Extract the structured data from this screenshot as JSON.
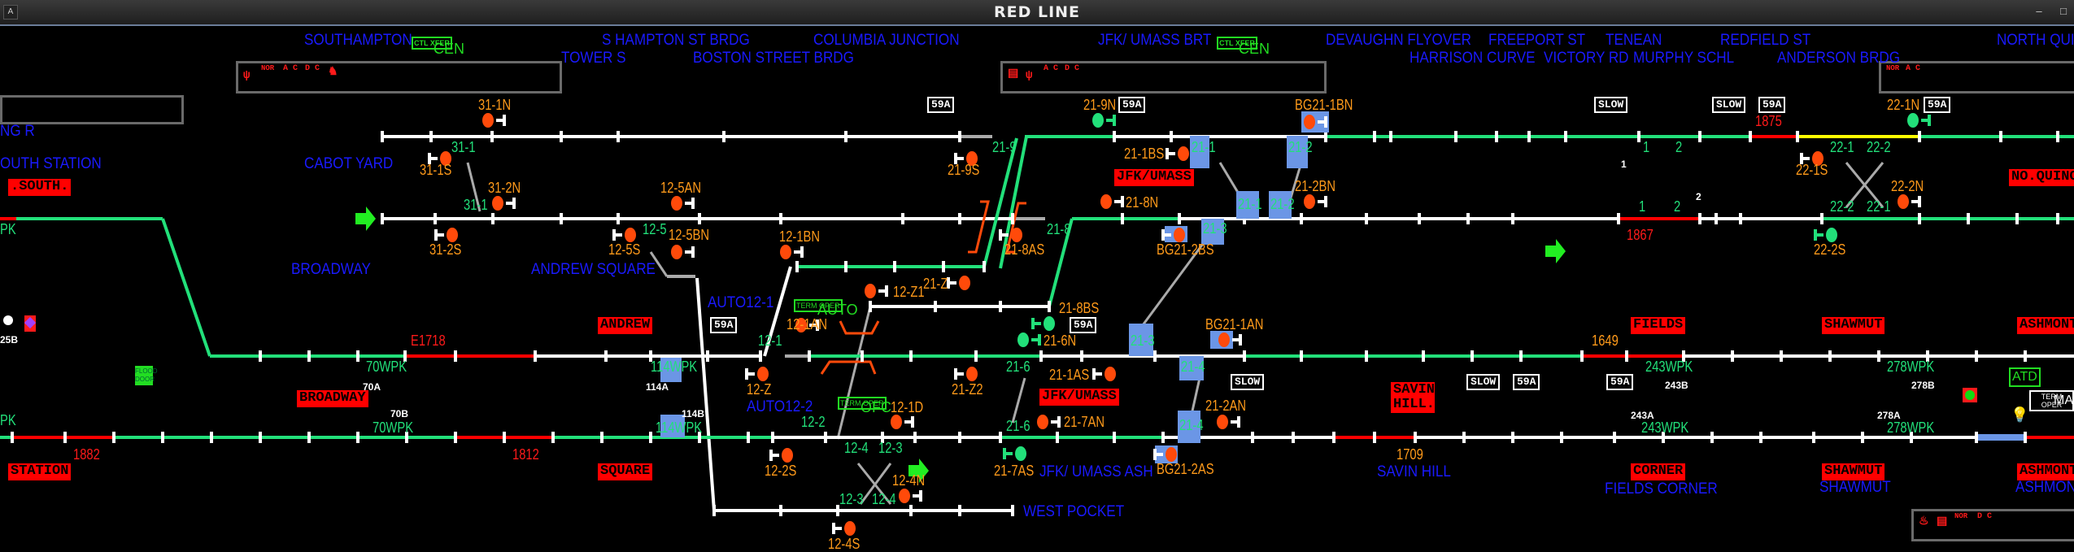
{
  "window": {
    "title": "RED LINE",
    "app_icon": "A",
    "minimize": "–",
    "maximize": "□"
  },
  "colors": {
    "track_idle": "#ffffff",
    "track_clear": "#22e07a",
    "track_occupied": "#ff0000",
    "track_locked": "#ffff00",
    "switch_box": "#6b96e6",
    "signal_stop": "#ff4a0a",
    "signal_clear": "#22e07a",
    "label_blue": "#1a1aff"
  },
  "locations_top": [
    {
      "id": "southampton",
      "text": "SOUTHAMPTON"
    },
    {
      "id": "s-hampton-st-brdg",
      "text": "S HAMPTON ST BRDG"
    },
    {
      "id": "columbia-junction",
      "text": "COLUMBIA JUNCTION"
    },
    {
      "id": "tower-s",
      "text": "TOWER S"
    },
    {
      "id": "boston-street-brdg",
      "text": "BOSTON STREET BRDG"
    },
    {
      "id": "jfk-umass-brt",
      "text": "JFK/ UMASS BRT"
    },
    {
      "id": "devaughn-flyover",
      "text": "DEVAUGHN FLYOVER"
    },
    {
      "id": "freeport-st",
      "text": "FREEPORT ST"
    },
    {
      "id": "tenean",
      "text": "TENEAN"
    },
    {
      "id": "redfield-st",
      "text": "REDFIELD ST"
    },
    {
      "id": "north-quincy",
      "text": "NORTH QUI"
    },
    {
      "id": "harrison-curve",
      "text": "HARRISON CURVE"
    },
    {
      "id": "victory-rd",
      "text": "VICTORY RD"
    },
    {
      "id": "murphy-schl",
      "text": "MURPHY SCHL"
    },
    {
      "id": "anderson-brdg",
      "text": "ANDERSON BRDG"
    }
  ],
  "locations_mid": [
    {
      "id": "ng-r",
      "text": "NG R"
    },
    {
      "id": "south-station",
      "text": "OUTH STATION"
    },
    {
      "id": "cabot-yard",
      "text": "CABOT YARD"
    },
    {
      "id": "broadway",
      "text": "BROADWAY"
    },
    {
      "id": "andrew-square",
      "text": "ANDREW SQUARE"
    },
    {
      "id": "auto12-1",
      "text": "AUTO12-1"
    },
    {
      "id": "auto12-2",
      "text": "AUTO12-2"
    },
    {
      "id": "west-pocket",
      "text": "WEST POCKET"
    },
    {
      "id": "jfk-umass-ash",
      "text": "JFK/ UMASS ASH"
    },
    {
      "id": "savin-hill",
      "text": "SAVIN HILL"
    },
    {
      "id": "fields-corner",
      "text": "FIELDS CORNER"
    },
    {
      "id": "shawmut",
      "text": "SHAWMUT"
    },
    {
      "id": "ashmont",
      "text": "ASHMON"
    }
  ],
  "control": {
    "ctl_xfer": "CTL XFER",
    "cen": "CEN",
    "term_oper": "TERM OPER",
    "auto": "AUTO",
    "ofc": "OFC",
    "atd": "ATD",
    "flood_door": "FLOOD DOOR",
    "ma": "MA"
  },
  "station_tags": [
    {
      "id": "south",
      "text": ".SOUTH."
    },
    {
      "id": "andrew",
      "text": "ANDREW"
    },
    {
      "id": "broadway",
      "text": "BROADWAY"
    },
    {
      "id": "station",
      "text": "STATION"
    },
    {
      "id": "square",
      "text": "SQUARE"
    },
    {
      "id": "jfk-umass-1",
      "text": "JFK/UMASS"
    },
    {
      "id": "jfk-umass-2",
      "text": "JFK/UMASS"
    },
    {
      "id": "savin-hill",
      "text": "SAVIN HILL."
    },
    {
      "id": "fields",
      "text": "FIELDS"
    },
    {
      "id": "corner",
      "text": "CORNER"
    },
    {
      "id": "shawmut-1",
      "text": "SHAWMUT"
    },
    {
      "id": "shawmut-2",
      "text": "SHAWMUT"
    },
    {
      "id": "ashmont-1",
      "text": "ASHMONT"
    },
    {
      "id": "ashmont-2",
      "text": "ASHMONT"
    },
    {
      "id": "no-quincy",
      "text": "NO.QUINC"
    }
  ],
  "signals": [
    {
      "id": "31-1N",
      "text": "31-1N",
      "state": "stop"
    },
    {
      "id": "31-1S",
      "text": "31-1S",
      "state": "stop"
    },
    {
      "id": "31-2N",
      "text": "31-2N",
      "state": "stop"
    },
    {
      "id": "31-2S",
      "text": "31-2S",
      "state": "stop"
    },
    {
      "id": "12-5AN",
      "text": "12-5AN",
      "state": "stop"
    },
    {
      "id": "12-5S",
      "text": "12-5S",
      "state": "stop"
    },
    {
      "id": "12-5BN",
      "text": "12-5BN",
      "state": "stop"
    },
    {
      "id": "12-1BN",
      "text": "12-1BN",
      "state": "stop"
    },
    {
      "id": "12-1AN",
      "text": "12-1AN",
      "state": "stop"
    },
    {
      "id": "12-Z1",
      "text": "12-Z1",
      "state": "stop"
    },
    {
      "id": "21-Z",
      "text": "21-Z",
      "state": "stop"
    },
    {
      "id": "12-Z",
      "text": "12-Z",
      "state": "stop"
    },
    {
      "id": "21-Z2",
      "text": "21-Z2",
      "state": "stop"
    },
    {
      "id": "12-2S",
      "text": "12-2S",
      "state": "stop"
    },
    {
      "id": "12-4N",
      "text": "12-4N",
      "state": "stop"
    },
    {
      "id": "12-4S",
      "text": "12-4S",
      "state": "stop"
    },
    {
      "id": "12-1D",
      "text": "12-1D",
      "state": "stop"
    },
    {
      "id": "21-9S",
      "text": "21-9S",
      "state": "stop"
    },
    {
      "id": "21-9N",
      "text": "21-9N",
      "state": "clear"
    },
    {
      "id": "21-8AS",
      "text": "21-8AS",
      "state": "stop"
    },
    {
      "id": "21-8N",
      "text": "21-8N",
      "state": "stop"
    },
    {
      "id": "21-8BS",
      "text": "21-8BS",
      "state": "clear"
    },
    {
      "id": "21-6N",
      "text": "21-6N",
      "state": "clear"
    },
    {
      "id": "21-1AS",
      "text": "21-1AS",
      "state": "stop"
    },
    {
      "id": "21-7AN",
      "text": "21-7AN",
      "state": "stop"
    },
    {
      "id": "21-7AS",
      "text": "21-7AS",
      "state": "clear"
    },
    {
      "id": "21-1BS",
      "text": "21-1BS",
      "state": "stop"
    },
    {
      "id": "BG21-1BN",
      "text": "BG21-1BN",
      "state": "stop"
    },
    {
      "id": "21-2BN",
      "text": "21-2BN",
      "state": "stop"
    },
    {
      "id": "BG21-2BS",
      "text": "BG21-2BS",
      "state": "stop"
    },
    {
      "id": "BG21-1AN",
      "text": "BG21-1AN",
      "state": "stop"
    },
    {
      "id": "21-2AN",
      "text": "21-2AN",
      "state": "stop"
    },
    {
      "id": "BG21-2AS",
      "text": "BG21-2AS",
      "state": "stop"
    },
    {
      "id": "22-1S",
      "text": "22-1S",
      "state": "stop"
    },
    {
      "id": "22-1N",
      "text": "22-1N",
      "state": "clear"
    },
    {
      "id": "22-2N",
      "text": "22-2N",
      "state": "stop"
    },
    {
      "id": "22-2S",
      "text": "22-2S",
      "state": "clear"
    }
  ],
  "switch_labels": {
    "s31_1a": "31-1",
    "s31_1b": "31-1",
    "s12_5": "12-5",
    "s12_1": "12-1",
    "s12_2": "12-2",
    "s12_4a": "12-4",
    "s12_3a": "12-3",
    "s12_3b": "12-3",
    "s12_4b": "12-4",
    "s21_9": "21-9",
    "s21_8": "21-8",
    "s21_6a": "21-6",
    "s21_6b": "21-6",
    "s21_1a": "21-1",
    "s21_2a": "21-2",
    "s21_1b": "21-1",
    "s21_2b": "21-2",
    "s21_3a": "21-3",
    "s21_3b": "21-3",
    "s21_4a": "21-4",
    "s21_4b": "21-4",
    "x1a": "1",
    "x2a": "2",
    "x1b": "1",
    "x2b": "2",
    "s22_1a": "22-1",
    "s22_2a": "22-2",
    "s22_2b": "22-2",
    "s22_1b": "22-1"
  },
  "wpk_labels": {
    "pk_a": "PK",
    "pk_b": "PK",
    "w70a": "70WPK",
    "w70b": "70WPK",
    "w114a": "114WPK",
    "w114b": "114WPK",
    "w243a": "243WPK",
    "w243b": "243WPK",
    "w278a": "278WPK",
    "w278b": "278WPK",
    "a70": "70A",
    "b70": "70B",
    "a114": "114A",
    "b114": "114B",
    "a243": "243A",
    "b243": "243B",
    "a278": "278A",
    "b278": "278B",
    "b25": "25B",
    "d1": "1",
    "d2": "2"
  },
  "track_circuits": {
    "c1875": "1875",
    "c1867": "1867",
    "e1718": "E1718",
    "c1649": "1649",
    "c1882": "1882",
    "c1812": "1812",
    "c1709": "1709"
  },
  "speed_signs": {
    "s59a": "59A",
    "slow": "SLOW"
  },
  "alarm_icons": {
    "ac": "A C",
    "dc": "D C",
    "nor": "NOR"
  }
}
